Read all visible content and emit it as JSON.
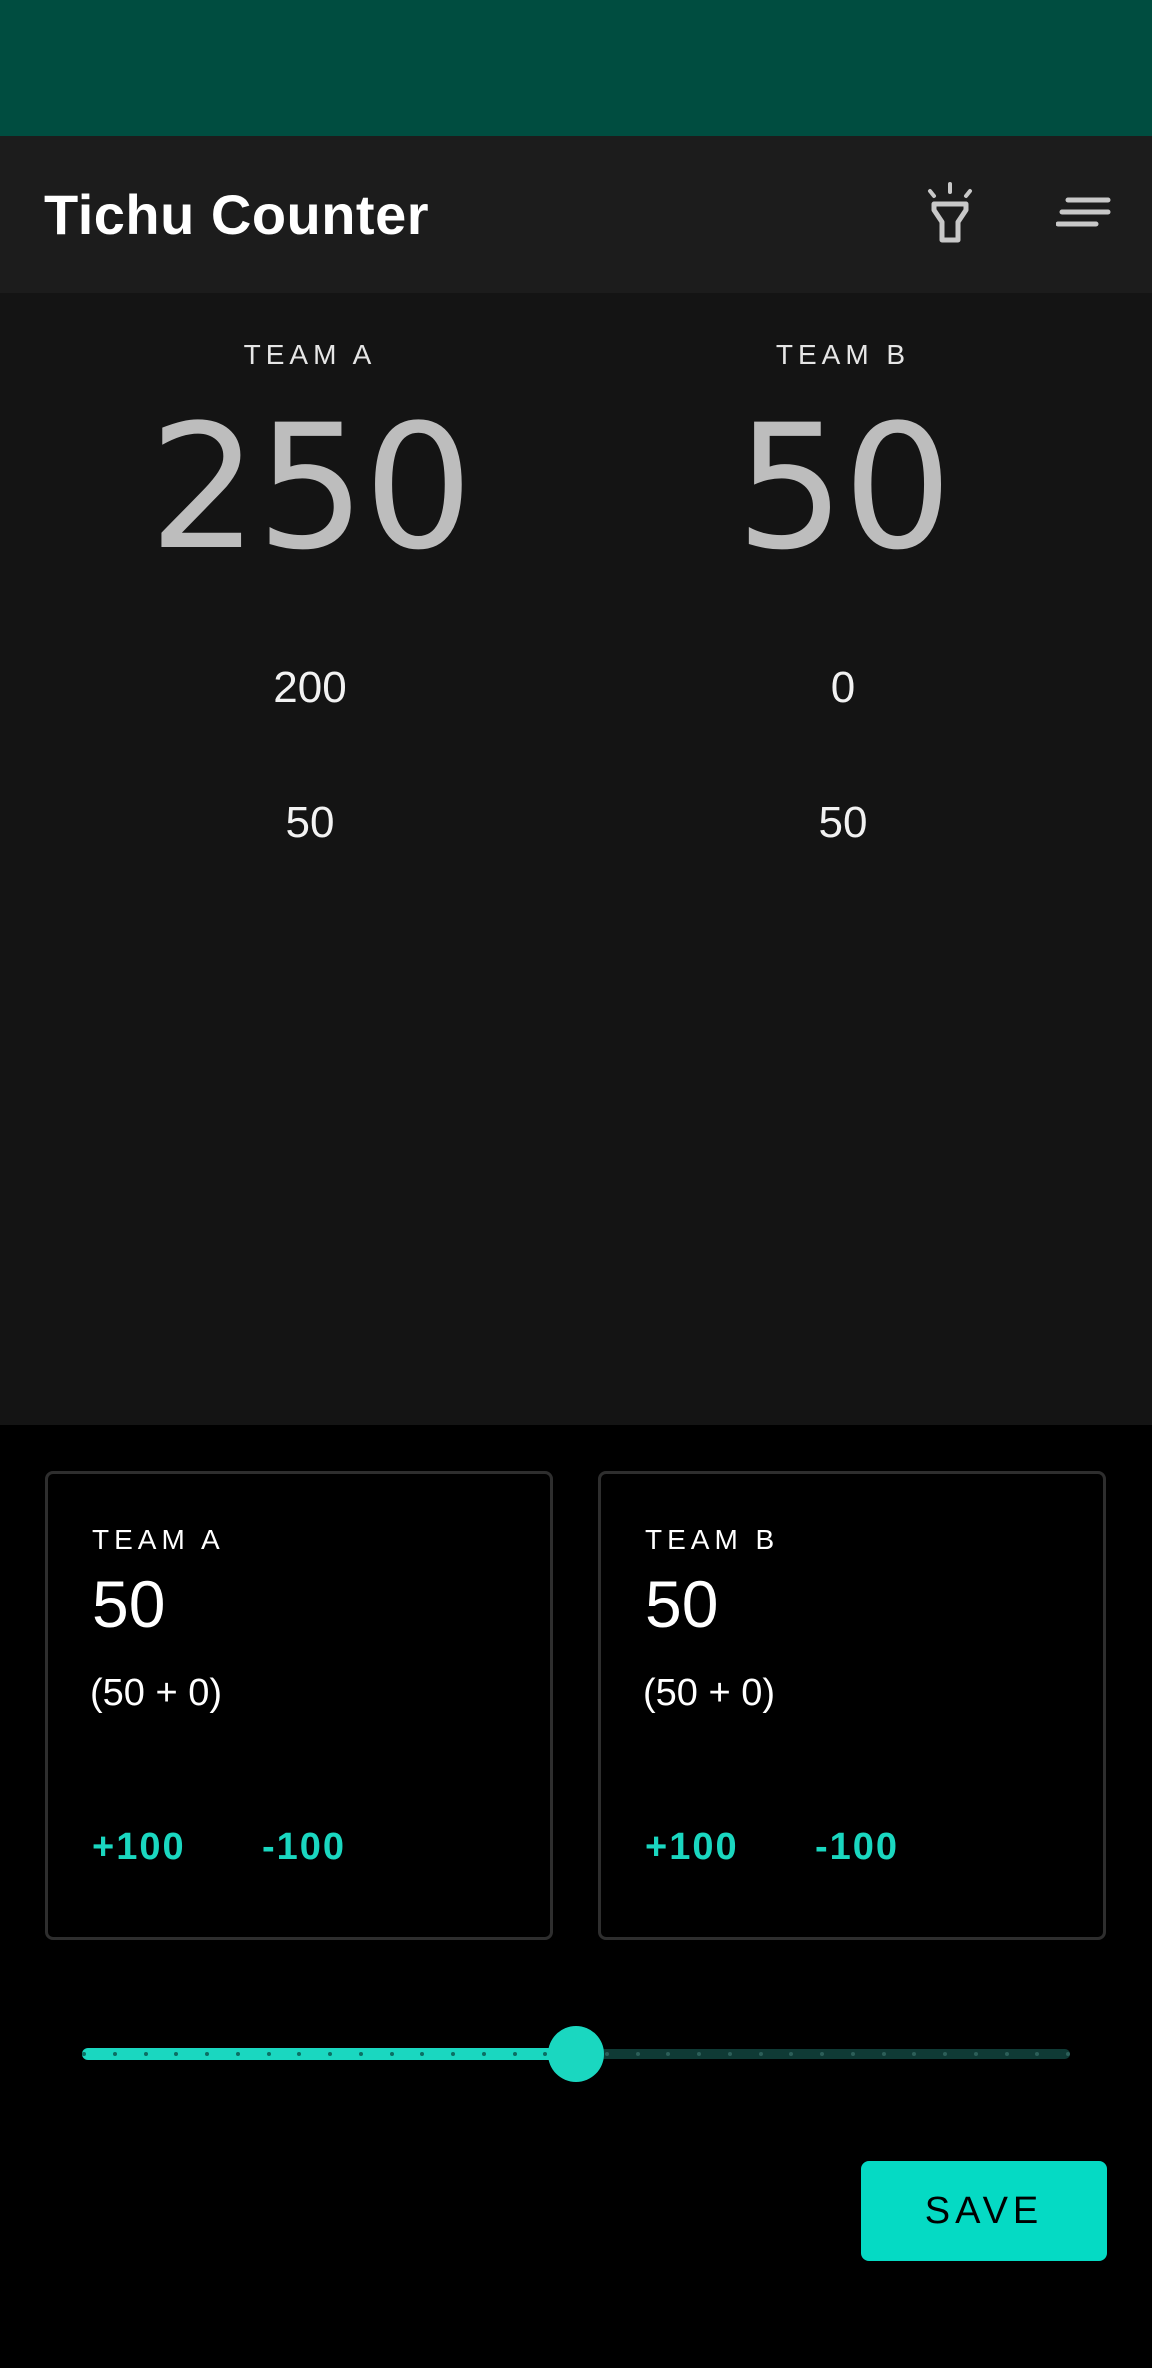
{
  "app": {
    "title": "Tichu Counter",
    "icons": {
      "flashlight": "flashlight-icon",
      "menu": "menu-icon"
    }
  },
  "scoreboard": {
    "team_a": {
      "label": "TEAM A",
      "total": "250",
      "rounds": [
        "200",
        "50"
      ]
    },
    "team_b": {
      "label": "TEAM B",
      "total": "50",
      "rounds": [
        "0",
        "50"
      ]
    }
  },
  "entry": {
    "team_a": {
      "label": "TEAM A",
      "score": "50",
      "breakdown": "(50 + 0)",
      "plus_label": "+100",
      "minus_label": "-100"
    },
    "team_b": {
      "label": "TEAM B",
      "score": "50",
      "breakdown": "(50 + 0)",
      "plus_label": "+100",
      "minus_label": "-100"
    }
  },
  "slider": {
    "fraction": 0.5,
    "steps": 33
  },
  "actions": {
    "save_label": "SAVE"
  },
  "colors": {
    "status_bar": "#004d40",
    "app_bar": "#1c1c1c",
    "accent": "#05dac4",
    "background": "#000000"
  }
}
